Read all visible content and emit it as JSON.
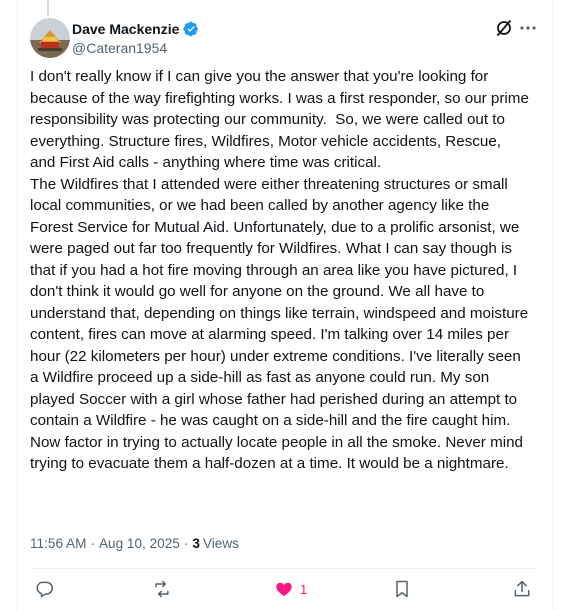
{
  "author": {
    "display_name": "Dave Mackenzie",
    "handle": "@Cateran1954",
    "verified": true
  },
  "icons": {
    "verified": "verified-badge-icon",
    "grok": "grok-icon",
    "more": "more-icon",
    "reply": "reply-icon",
    "repost": "repost-icon",
    "like": "heart-icon",
    "bookmark": "bookmark-icon",
    "share": "share-icon"
  },
  "colors": {
    "verified": "#1d9bf0",
    "like": "#f91880",
    "text": "#0f1419",
    "muted": "#536471"
  },
  "post": {
    "text": "I don't really know if I can give you the answer that you're looking for because of the way firefighting works. I was a first responder, so our prime responsibility was protecting our community.  So, we were called out to everything. Structure fires, Wildfires, Motor vehicle accidents, Rescue, and First Aid calls - anything where time was critical.\nThe Wildfires that I attended were either threatening structures or small local communities, or we had been called by another agency like the Forest Service for Mutual Aid. Unfortunately, due to a prolific arsonist, we were paged out far too frequently for Wildfires. What I can say though is that if you had a hot fire moving through an area like you have pictured, I don't think it would go well for anyone on the ground. We all have to understand that, depending on things like terrain, windspeed and moisture content, fires can move at alarming speed. I'm talking over 14 miles per hour (22 kilometers per hour) under extreme conditions. I've literally seen a Wildfire proceed up a side-hill as fast as anyone could run. My son played Soccer with a girl whose father had perished during an attempt to contain a Wildfire - he was caught on a side-hill and the fire caught him.\nNow factor in trying to actually locate people in all the smoke. Never mind trying to evacuate them a half-dozen at a time. It would be a nightmare."
  },
  "meta": {
    "time": "11:56 AM",
    "separator": "·",
    "date": "Aug 10, 2025",
    "views_count": "3",
    "views_label": "Views"
  },
  "actions": {
    "like_count": "1",
    "liked": true
  }
}
